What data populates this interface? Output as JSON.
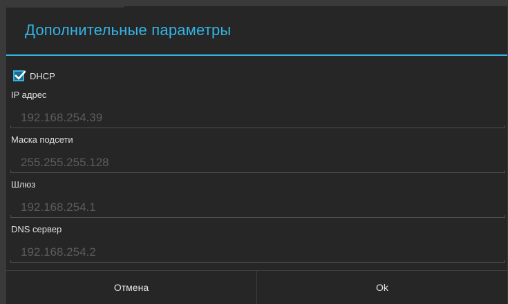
{
  "dialog": {
    "title": "Дополнительные параметры",
    "dhcp": {
      "label": "DHCP",
      "checked": true
    },
    "fields": [
      {
        "label": "IP адрес",
        "value": "192.168.254.39"
      },
      {
        "label": "Маска подсети",
        "value": "255.255.255.128"
      },
      {
        "label": "Шлюз",
        "value": "192.168.254.1"
      },
      {
        "label": "DNS сервер",
        "value": "192.168.254.2"
      }
    ],
    "buttons": {
      "cancel": "Отмена",
      "ok": "Ok"
    }
  },
  "colors": {
    "accent": "#33b5e5",
    "background": "#262626"
  }
}
